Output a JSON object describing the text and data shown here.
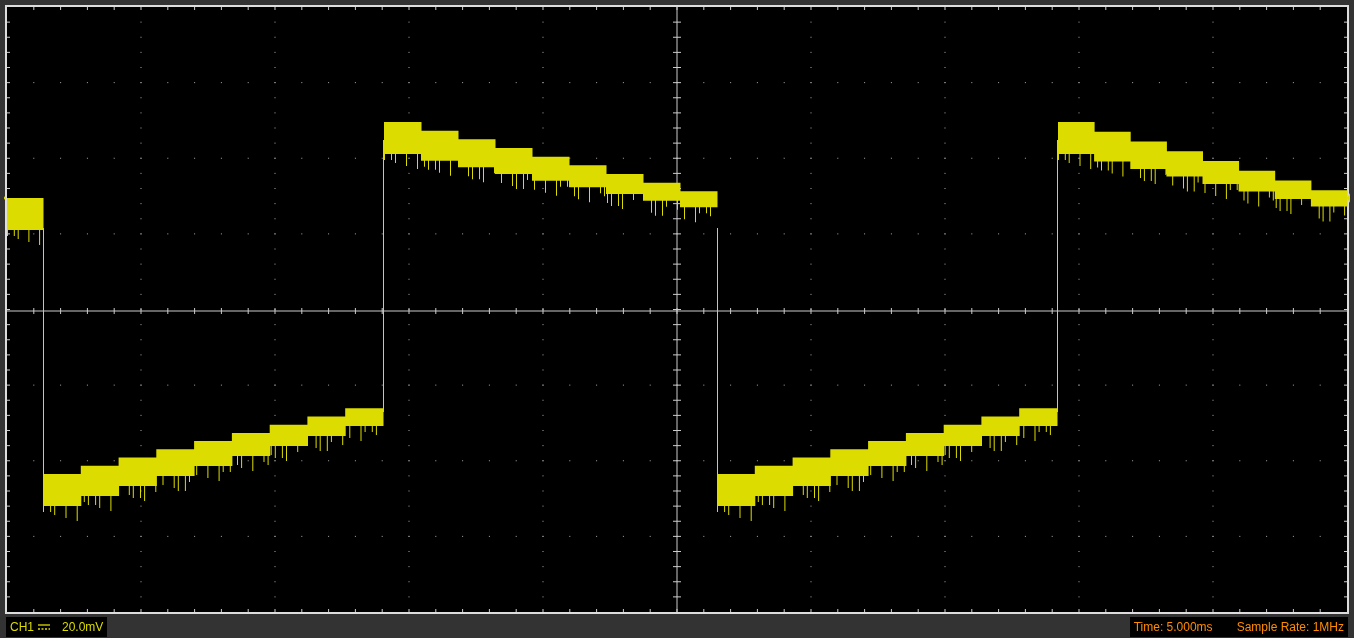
{
  "channel": {
    "label": "CH1",
    "scale": "20.0mV"
  },
  "status": {
    "time": "Time: 5.000ms",
    "sample_rate": "Sample Rate: 1MHz"
  }
}
